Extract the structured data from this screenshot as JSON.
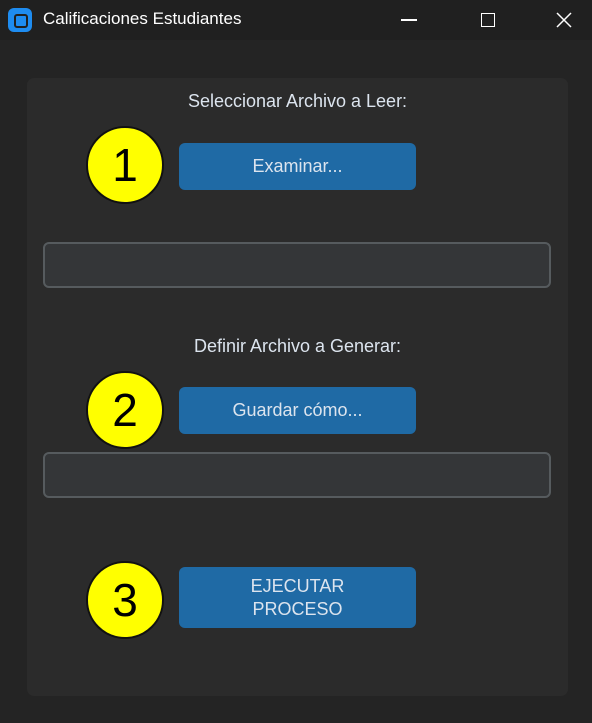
{
  "window": {
    "title": "Calificaciones Estudiantes",
    "accent": "#1f6aa5",
    "background": "#242424"
  },
  "panel": {
    "select_label": "Seleccionar Archivo a Leer:",
    "browse_button": "Examinar...",
    "input_file_value": "",
    "output_label": "Definir Archivo a Generar:",
    "save_button": "Guardar cómo...",
    "output_file_value": "",
    "run_button_line1": "EJECUTAR",
    "run_button_line2": "PROCESO"
  },
  "markers": [
    "1",
    "2",
    "3"
  ],
  "icons": {
    "app": "app-icon",
    "minimize": "minimize-icon",
    "maximize": "maximize-icon",
    "close": "close-icon"
  }
}
